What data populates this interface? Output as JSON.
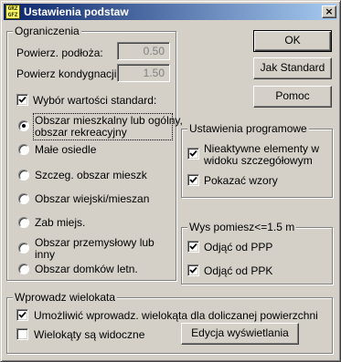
{
  "window": {
    "title": "Ustawienia podstaw",
    "app_icon": "grz-app-icon",
    "close_label": "×"
  },
  "ograniczenia": {
    "label": "Ograniczenia",
    "powierz_podloza": {
      "label": "Powierz. podłoża:",
      "value": "0.50"
    },
    "powierz_kondygnacji": {
      "label": "Powierz kondygnacji:",
      "value": "1.50"
    },
    "wybor_standard": {
      "label": "Wybór wartości standard:",
      "checked": true
    },
    "options": [
      {
        "line1": "Obszar mieszkalny lub ogólny,",
        "line2": "obszar rekreacyjny",
        "selected": true
      },
      {
        "line1": "Małe osiedle",
        "line2": "",
        "selected": false
      },
      {
        "line1": "Szczeg. obszar mieszk",
        "line2": "",
        "selected": false
      },
      {
        "line1": "Obszar wiejski/mieszan",
        "line2": "",
        "selected": false
      },
      {
        "line1": "Zab miejs.",
        "line2": "",
        "selected": false
      },
      {
        "line1": "Obszar przemysłowy lub",
        "line2": "inny",
        "selected": false
      },
      {
        "line1": "Obszar domków letn.",
        "line2": "",
        "selected": false
      }
    ]
  },
  "buttons": {
    "ok": "OK",
    "jak_standard": "Jak Standard",
    "pomoc": "Pomoc"
  },
  "ustawienia_programowe": {
    "label": "Ustawienia programowe",
    "nieaktywne": {
      "line1": "Nieaktywne elementy w",
      "line2": "widoku szczegółowym",
      "checked": true
    },
    "wzory": {
      "label": "Pokazać wzory",
      "checked": true
    }
  },
  "wys_pomiesz": {
    "label": "Wys pomiesz<=1.5 m",
    "ppp": {
      "label": "Odjąć od PPP",
      "checked": true
    },
    "ppk": {
      "label": "Odjąć od PPK",
      "checked": true
    }
  },
  "wprowadz_wielokata": {
    "label": "Wprowadz wielokata",
    "umozliwic": {
      "label": "Umożliwić wprowadz. wielokąta dla doliczanej powierzchni",
      "checked": true
    },
    "widoczne": {
      "label": "Wielokąty są widoczne",
      "checked": false
    },
    "edycja_button": "Edycja wyświetlania"
  },
  "colors": {
    "face": "#d4d0c8",
    "title_start": "#0a246a",
    "title_end": "#a6caf0"
  }
}
